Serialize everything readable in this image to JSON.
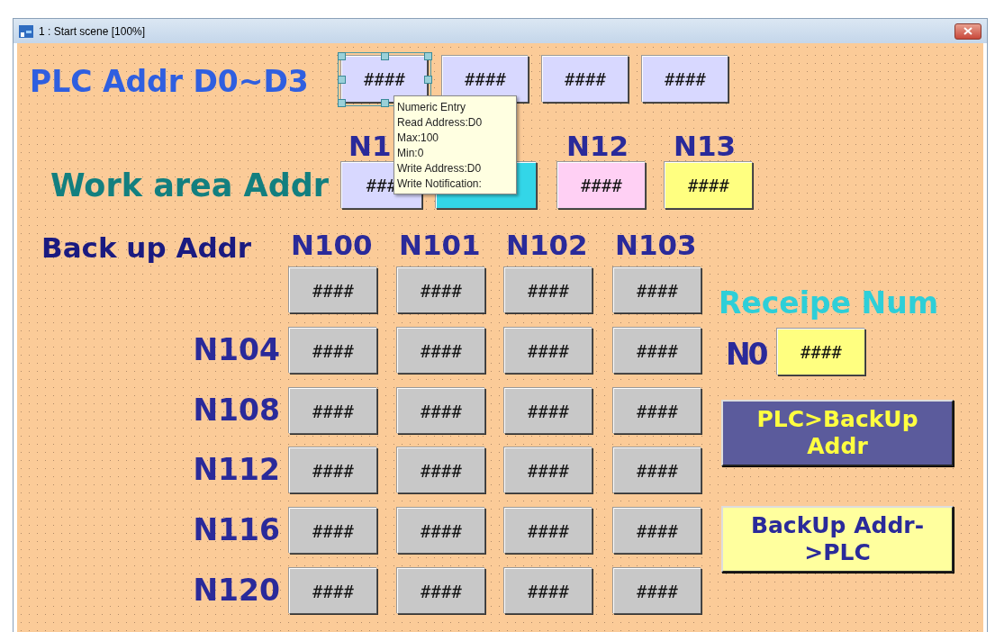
{
  "window": {
    "title": "1 : Start scene [100%]"
  },
  "plc_row": {
    "label": "PLC Addr D0~D3",
    "entries": [
      {
        "value": "####",
        "selected": true
      },
      {
        "value": "####",
        "selected": false
      },
      {
        "value": "####",
        "selected": false
      },
      {
        "value": "####",
        "selected": false
      }
    ]
  },
  "tooltip": {
    "lines": [
      "Numeric Entry",
      "Read Address:D0",
      "Max:100",
      "Min:0",
      "Write Address:D0",
      "Write Notification:"
    ]
  },
  "work_area": {
    "label": "Work area Addr",
    "entries": [
      {
        "header": "N1",
        "value": "###",
        "color": "#d8d8ff"
      },
      {
        "color": "#33d6e8"
      },
      {
        "header": "N12",
        "value": "####",
        "color": "#ffd0f4"
      },
      {
        "header": "N13",
        "value": "####",
        "color": "#ffff80"
      }
    ]
  },
  "backup": {
    "label": "Back up Addr",
    "columns": [
      "N100",
      "N101",
      "N102",
      "N103"
    ],
    "rows": [
      {
        "cells": [
          "####",
          "####",
          "####",
          "####"
        ]
      },
      {
        "label": "N104",
        "cells": [
          "####",
          "####",
          "####",
          "####"
        ]
      },
      {
        "label": "N108",
        "cells": [
          "####",
          "####",
          "####",
          "####"
        ]
      },
      {
        "label": "N112",
        "cells": [
          "####",
          "####",
          "####",
          "####"
        ]
      },
      {
        "label": "N116",
        "cells": [
          "####",
          "####",
          "####",
          "####"
        ]
      },
      {
        "label": "N120",
        "cells": [
          "####",
          "####",
          "####",
          "####"
        ]
      }
    ]
  },
  "recipe": {
    "title": "Receipe Num",
    "label": "N0",
    "value": "####"
  },
  "buttons": [
    {
      "label": "PLC>BackUp Addr",
      "kind": "dark"
    },
    {
      "label": "BackUp Addr->PLC",
      "kind": "light"
    }
  ]
}
